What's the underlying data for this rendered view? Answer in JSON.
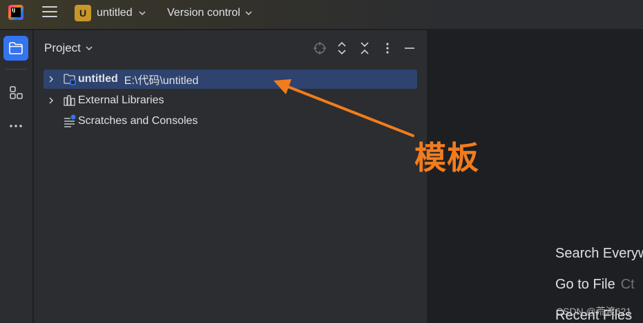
{
  "titlebar": {
    "app_logo_text": "IJ",
    "project_badge": "U",
    "project_name": "untitled",
    "vcs_label": "Version control"
  },
  "toolstrip": {
    "items": [
      {
        "icon": "folder-icon",
        "active": true
      },
      {
        "icon": "structure-icon",
        "active": false
      },
      {
        "icon": "more-icon",
        "active": false
      }
    ]
  },
  "panel": {
    "title": "Project",
    "tree": [
      {
        "label": "untitled",
        "path": "E:\\代码\\untitled",
        "icon": "module-folder-icon",
        "expandable": true,
        "selected": true
      },
      {
        "label": "External Libraries",
        "icon": "library-icon",
        "expandable": true,
        "selected": false
      },
      {
        "label": "Scratches and Consoles",
        "icon": "scratches-icon",
        "expandable": false,
        "selected": false
      }
    ]
  },
  "editor": {
    "hints": [
      {
        "label": "Search Everyw",
        "key": ""
      },
      {
        "label": "Go to File",
        "key": "Ct"
      },
      {
        "label": "Recent Files",
        "key": ""
      }
    ]
  },
  "annotation": {
    "label": "模板",
    "color": "#f27c1c"
  },
  "watermark": "CSDN @荒渡621"
}
